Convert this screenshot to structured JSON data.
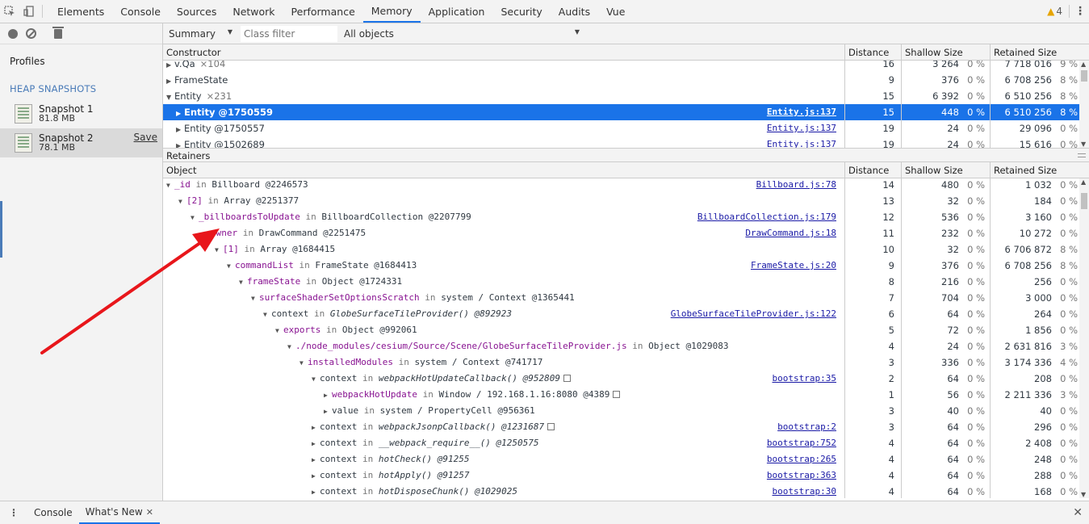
{
  "topbar": {
    "tabs": [
      "Elements",
      "Console",
      "Sources",
      "Network",
      "Performance",
      "Memory",
      "Application",
      "Security",
      "Audits",
      "Vue"
    ],
    "active_tab": "Memory",
    "warning_count": "4"
  },
  "sidebar": {
    "profiles_label": "Profiles",
    "section_label": "HEAP SNAPSHOTS",
    "snapshots": [
      {
        "name": "Snapshot 1",
        "size": "81.8 MB"
      },
      {
        "name": "Snapshot 2",
        "size": "78.1 MB",
        "save": "Save"
      }
    ]
  },
  "toolbar": {
    "view": "Summary",
    "class_filter_placeholder": "Class filter",
    "objects": "All objects"
  },
  "constructors": {
    "headers": {
      "constructor": "Constructor",
      "distance": "Distance",
      "shallow": "Shallow Size",
      "retained": "Retained Size"
    },
    "rows": [
      {
        "name": "v.Qa",
        "count": "×104",
        "distance": "16",
        "shallow": "3 264",
        "shallow_pct": "0 %",
        "retained": "7 718 016",
        "retained_pct": "9 %"
      },
      {
        "name": "FrameState",
        "count": "",
        "distance": "9",
        "shallow": "376",
        "shallow_pct": "0 %",
        "retained": "6 708 256",
        "retained_pct": "8 %"
      },
      {
        "name": "Entity",
        "count": "×231",
        "distance": "15",
        "shallow": "6 392",
        "shallow_pct": "0 %",
        "retained": "6 510 256",
        "retained_pct": "8 %"
      },
      {
        "name": "Entity @1750559",
        "link": "Entity.js:137",
        "distance": "15",
        "shallow": "448",
        "shallow_pct": "0 %",
        "retained": "6 510 256",
        "retained_pct": "8 %"
      },
      {
        "name": "Entity @1750557",
        "link": "Entity.js:137",
        "distance": "19",
        "shallow": "24",
        "shallow_pct": "0 %",
        "retained": "29 096",
        "retained_pct": "0 %"
      },
      {
        "name": "Entity @1502689",
        "link": "Entity.js:137",
        "distance": "19",
        "shallow": "24",
        "shallow_pct": "0 %",
        "retained": "15 616",
        "retained_pct": "0 %"
      }
    ]
  },
  "retainers": {
    "title": "Retainers",
    "headers": {
      "object": "Object",
      "distance": "Distance",
      "shallow": "Shallow Size",
      "retained": "Retained Size"
    },
    "rows": [
      {
        "prop": "_id",
        "in": " in ",
        "owner": "Billboard @2246573",
        "link": "Billboard.js:78",
        "distance": "14",
        "shallow": "480",
        "shallow_pct": "0 %",
        "retained": "1 032",
        "retained_pct": "0 %"
      },
      {
        "prop": "[2]",
        "in": " in ",
        "owner": "Array @2251377",
        "link": "",
        "distance": "13",
        "shallow": "32",
        "shallow_pct": "0 %",
        "retained": "184",
        "retained_pct": "0 %"
      },
      {
        "prop": "_billboardsToUpdate",
        "in": " in ",
        "owner": "BillboardCollection @2207799",
        "link": "BillboardCollection.js:179",
        "distance": "12",
        "shallow": "536",
        "shallow_pct": "0 %",
        "retained": "3 160",
        "retained_pct": "0 %"
      },
      {
        "prop": "owner",
        "in": " in ",
        "owner": "DrawCommand @2251475",
        "link": "DrawCommand.js:18",
        "distance": "11",
        "shallow": "232",
        "shallow_pct": "0 %",
        "retained": "10 272",
        "retained_pct": "0 %"
      },
      {
        "prop": "[1]",
        "in": " in ",
        "owner": "Array @1684415",
        "link": "",
        "distance": "10",
        "shallow": "32",
        "shallow_pct": "0 %",
        "retained": "6 706 872",
        "retained_pct": "8 %"
      },
      {
        "prop": "commandList",
        "in": " in ",
        "owner": "FrameState @1684413",
        "link": "FrameState.js:20",
        "distance": "9",
        "shallow": "376",
        "shallow_pct": "0 %",
        "retained": "6 708 256",
        "retained_pct": "8 %"
      },
      {
        "prop": "frameState",
        "in": " in ",
        "owner": "Object @1724331",
        "link": "",
        "distance": "8",
        "shallow": "216",
        "shallow_pct": "0 %",
        "retained": "256",
        "retained_pct": "0 %"
      },
      {
        "prop": "surfaceShaderSetOptionsScratch",
        "in": " in ",
        "owner": "system / Context @1365441",
        "link": "",
        "distance": "7",
        "shallow": "704",
        "shallow_pct": "0 %",
        "retained": "3 000",
        "retained_pct": "0 %"
      },
      {
        "prop": "context",
        "in": " in ",
        "owner": "GlobeSurfaceTileProvider() @892923",
        "link": "GlobeSurfaceTileProvider.js:122",
        "distance": "6",
        "shallow": "64",
        "shallow_pct": "0 %",
        "retained": "264",
        "retained_pct": "0 %"
      },
      {
        "prop": "exports",
        "in": " in ",
        "owner": "Object @992061",
        "link": "",
        "distance": "5",
        "shallow": "72",
        "shallow_pct": "0 %",
        "retained": "1 856",
        "retained_pct": "0 %"
      },
      {
        "prop": "./node_modules/cesium/Source/Scene/GlobeSurfaceTileProvider.js",
        "in": " in ",
        "owner": "Object @1029083",
        "link": "",
        "distance": "4",
        "shallow": "24",
        "shallow_pct": "0 %",
        "retained": "2 631 816",
        "retained_pct": "3 %"
      },
      {
        "prop": "installedModules",
        "in": " in ",
        "owner": "system / Context @741717",
        "link": "",
        "distance": "3",
        "shallow": "336",
        "shallow_pct": "0 %",
        "retained": "3 174 336",
        "retained_pct": "4 %"
      },
      {
        "prop": "context",
        "in": " in ",
        "owner": "webpackHotUpdateCallback() @952809",
        "link": "bootstrap:35",
        "distance": "2",
        "shallow": "64",
        "shallow_pct": "0 %",
        "retained": "208",
        "retained_pct": "0 %"
      },
      {
        "prop": "webpackHotUpdate",
        "in": " in ",
        "owner": "Window / 192.168.1.16:8080 @4389",
        "link": "",
        "distance": "1",
        "shallow": "56",
        "shallow_pct": "0 %",
        "retained": "2 211 336",
        "retained_pct": "3 %"
      },
      {
        "prop": "value",
        "in": " in ",
        "owner": "system / PropertyCell @956361",
        "link": "",
        "distance": "3",
        "shallow": "40",
        "shallow_pct": "0 %",
        "retained": "40",
        "retained_pct": "0 %"
      },
      {
        "prop": "context",
        "in": " in ",
        "owner": "webpackJsonpCallback() @1231687",
        "link": "bootstrap:2",
        "distance": "3",
        "shallow": "64",
        "shallow_pct": "0 %",
        "retained": "296",
        "retained_pct": "0 %"
      },
      {
        "prop": "context",
        "in": " in ",
        "owner": "__webpack_require__() @1250575",
        "link": "bootstrap:752",
        "distance": "4",
        "shallow": "64",
        "shallow_pct": "0 %",
        "retained": "2 408",
        "retained_pct": "0 %"
      },
      {
        "prop": "context",
        "in": " in ",
        "owner": "hotCheck() @91255",
        "link": "bootstrap:265",
        "distance": "4",
        "shallow": "64",
        "shallow_pct": "0 %",
        "retained": "248",
        "retained_pct": "0 %"
      },
      {
        "prop": "context",
        "in": " in ",
        "owner": "hotApply() @91257",
        "link": "bootstrap:363",
        "distance": "4",
        "shallow": "64",
        "shallow_pct": "0 %",
        "retained": "288",
        "retained_pct": "0 %"
      },
      {
        "prop": "context",
        "in": " in ",
        "owner": "hotDisposeChunk() @1029025",
        "link": "bootstrap:30",
        "distance": "4",
        "shallow": "64",
        "shallow_pct": "0 %",
        "retained": "168",
        "retained_pct": "0 %"
      }
    ]
  },
  "drawer": {
    "tabs": [
      "Console",
      "What's New"
    ],
    "active_tab": "What's New"
  },
  "annotation": {
    "color": "#e8161b"
  }
}
